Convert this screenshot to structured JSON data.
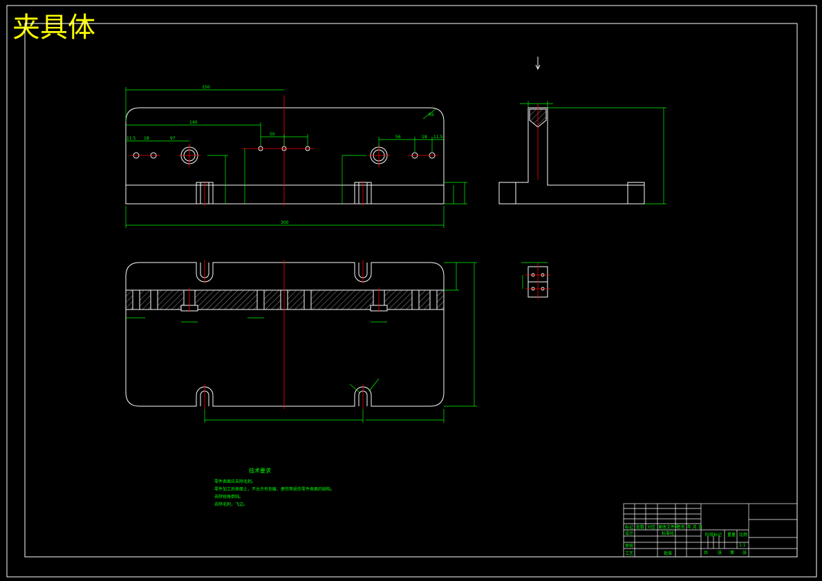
{
  "drawing": {
    "title": "夹具体",
    "colors": {
      "background": "#000000",
      "outline": "#ffffff",
      "dimension": "#00ff00",
      "centerline": "#ff0000",
      "title": "#ffff00"
    }
  },
  "tech_notes": {
    "heading": "技术要求",
    "items": [
      "零件表面应去除毛刺。",
      "零件加工后表面上，不允许有划痕、擦伤等损伤零件表面的缺陷。",
      "去除锐角倒钝。",
      "去除毛刺，飞边。"
    ]
  },
  "dims": {
    "front_overall": "300",
    "front_half": "150",
    "front_140": "140",
    "front_115_left": "11.5",
    "front_115_right": "11.5",
    "front_18_left": "18",
    "front_18_right": "18",
    "front_97": "97",
    "front_50": "50",
    "front_56": "56",
    "front_r": "R5"
  },
  "title_block": {
    "row1": [
      "标记",
      "处数",
      "分区",
      "更改文件号",
      "签名",
      "年.月.日"
    ],
    "design": "设计",
    "std": "标准化",
    "stage": "阶段标记",
    "weight": "重量",
    "scale": "比例",
    "check": "审核",
    "process": "工艺",
    "approve": "批准",
    "scale_val": "1:1",
    "sheets": [
      "共",
      "张",
      "第",
      "张"
    ]
  }
}
